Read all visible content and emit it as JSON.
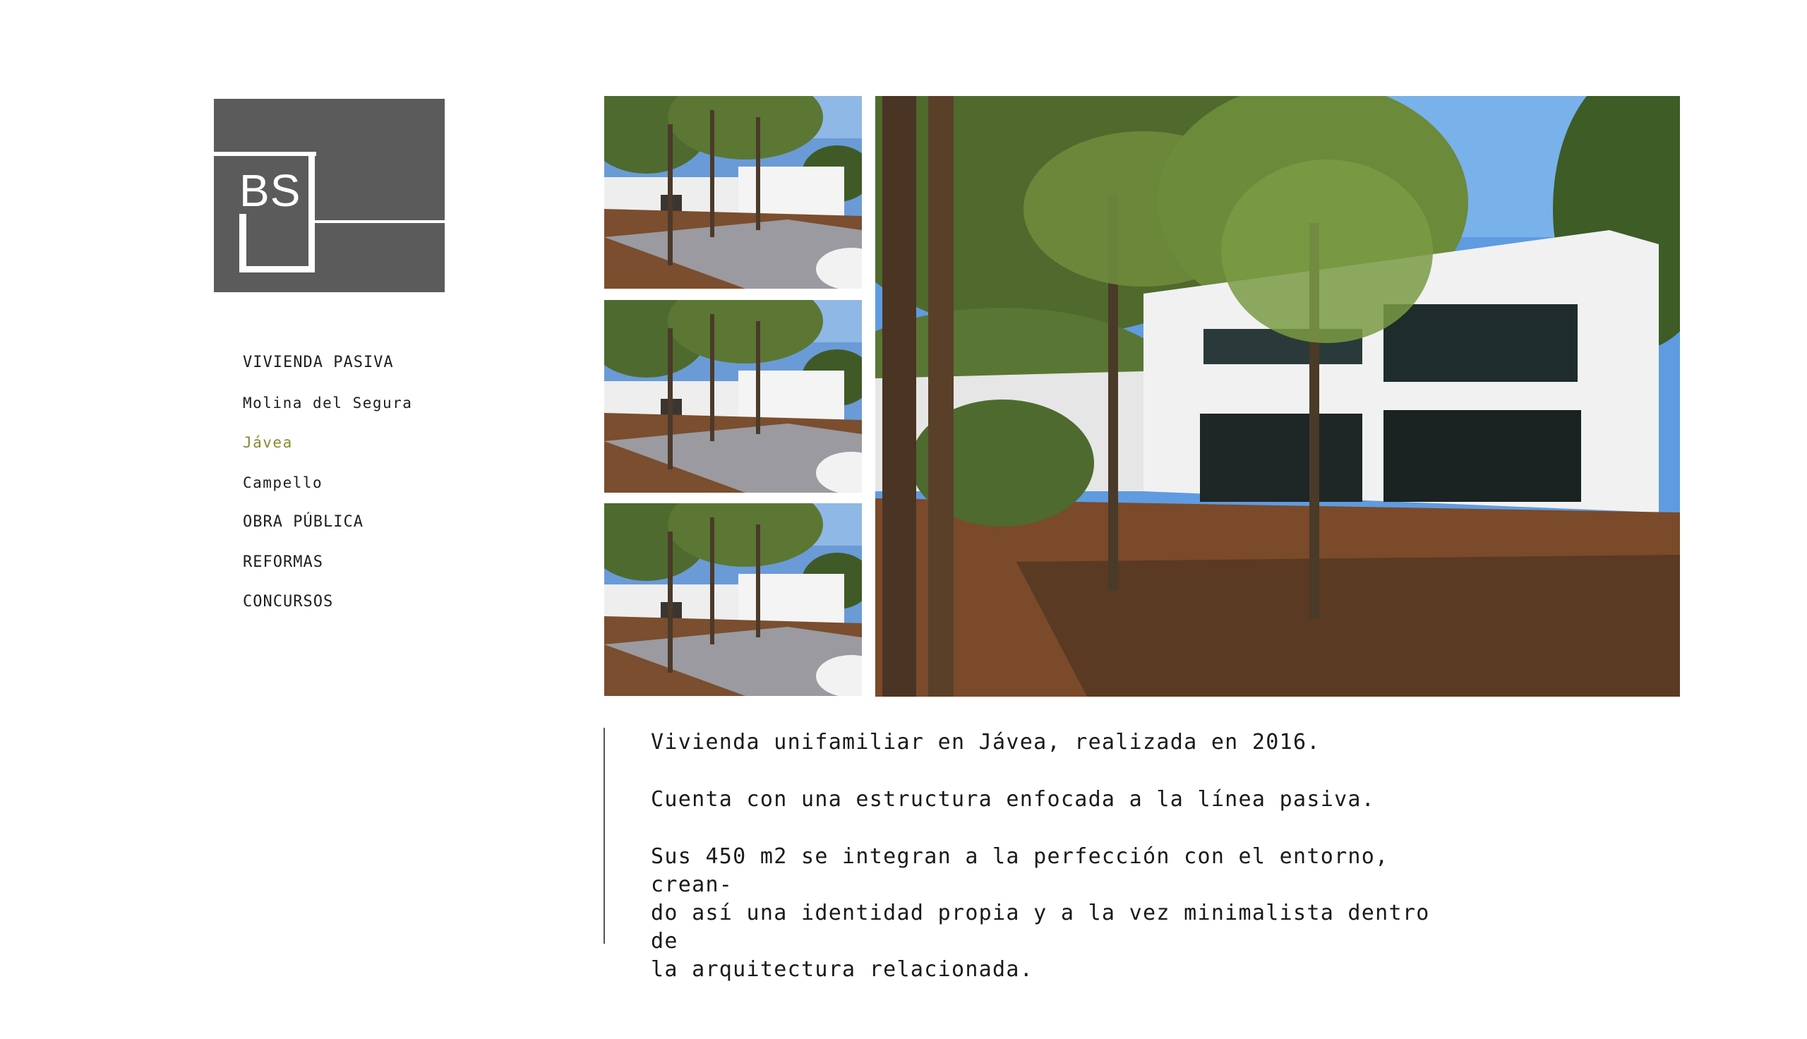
{
  "logo": {
    "monogram": "BS"
  },
  "nav": {
    "items": [
      {
        "label": "VIVIENDA PASIVA",
        "type": "section"
      },
      {
        "label": "Molina del Segura",
        "type": "sub"
      },
      {
        "label": "Jávea",
        "type": "sub",
        "active": true
      },
      {
        "label": "Campello",
        "type": "sub"
      },
      {
        "label": "OBRA PÚBLICA",
        "type": "section"
      },
      {
        "label": "REFORMAS",
        "type": "section"
      },
      {
        "label": "CONCURSOS",
        "type": "section"
      }
    ]
  },
  "colors": {
    "logo_bg": "#5b5b5b",
    "active_nav": "#8a8a2e",
    "text": "#1a1a1a"
  },
  "gallery": {
    "thumbnails": [
      "house-exterior-photo",
      "house-exterior-photo",
      "house-exterior-photo"
    ],
    "main": "house-garden-photo"
  },
  "description": {
    "p1": "Vivienda unifamiliar en Jávea, realizada en 2016.",
    "p2": "Cuenta con una estructura enfocada a la línea pasiva.",
    "p3": "Sus 450 m2 se integran a la perfección con el entorno, crean-\ndo así una identidad propia y a la vez minimalista dentro de\nla arquitectura relacionada."
  }
}
